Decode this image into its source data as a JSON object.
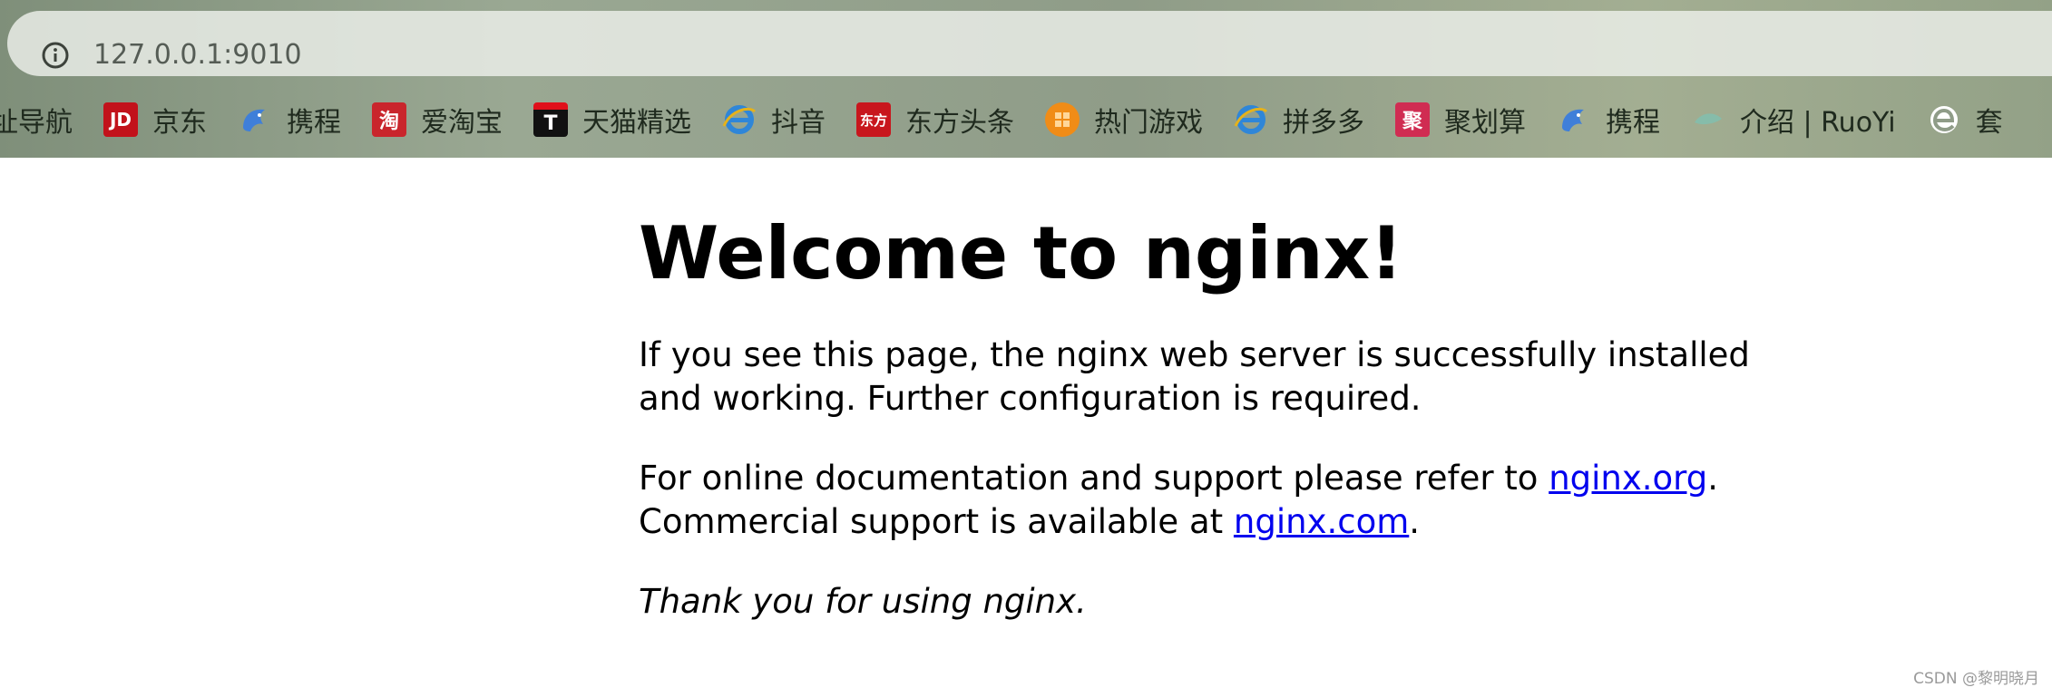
{
  "browser": {
    "url": "127.0.0.1:9010",
    "bookmarks": [
      {
        "label": "址导航",
        "icon": "none"
      },
      {
        "label": "京东",
        "icon": "jd-icon",
        "icon_text": "JD",
        "color": "#c2121b"
      },
      {
        "label": "携程",
        "icon": "dolphin-icon",
        "color": "#3f7fd9"
      },
      {
        "label": "爱淘宝",
        "icon": "taobao-icon",
        "icon_text": "淘",
        "color": "#c9252c"
      },
      {
        "label": "天猫精选",
        "icon": "tmall-icon",
        "icon_text": "T",
        "color": "#111111"
      },
      {
        "label": "抖音",
        "icon": "ie-e-icon",
        "color": "#2f86d8"
      },
      {
        "label": "东方头条",
        "icon": "dongfang-icon",
        "icon_text": "东方",
        "color": "#c8161d"
      },
      {
        "label": "热门游戏",
        "icon": "game-icon",
        "color": "#f08c17"
      },
      {
        "label": "拼多多",
        "icon": "ie-e-icon",
        "color": "#2f86d8"
      },
      {
        "label": "聚划算",
        "icon": "juhuasuan-icon",
        "icon_text": "聚",
        "color": "#d02c52"
      },
      {
        "label": "携程",
        "icon": "dolphin-icon",
        "color": "#3f7fd9"
      },
      {
        "label": "介绍 | RuoYi",
        "icon": "ruoyi-leaf-icon",
        "color": "#7fc0b0"
      },
      {
        "label": "套",
        "icon": "edge-e-icon",
        "color": "#ffffff"
      }
    ]
  },
  "page": {
    "title": "Welcome to nginx!",
    "p1": "If you see this page, the nginx web server is successfully installed and working. Further configuration is required.",
    "p2_prefix": "For online documentation and support please refer to ",
    "link_org": "nginx.org",
    "p2_middle": ".",
    "p2_line2": "Commercial support is available at ",
    "link_com": "nginx.com",
    "p2_suffix": ".",
    "p3": "Thank you for using nginx."
  },
  "watermark": "CSDN @黎明晓月"
}
